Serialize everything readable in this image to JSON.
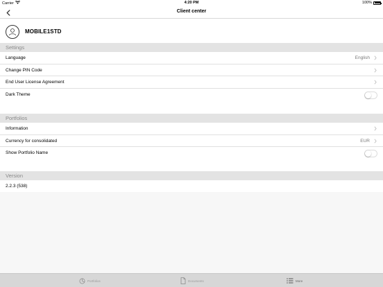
{
  "status_bar": {
    "carrier": "Carrier",
    "time": "4:20 PM",
    "battery": "100%"
  },
  "nav": {
    "title": "Client center"
  },
  "profile": {
    "name": "MOBILE1STD"
  },
  "settings": {
    "header": "Settings",
    "rows": [
      {
        "label": "Language",
        "value": "English"
      },
      {
        "label": "Change PIN Code",
        "value": ""
      },
      {
        "label": "End User License Agreement",
        "value": ""
      },
      {
        "label": "Dark Theme",
        "toggle": false
      }
    ]
  },
  "portfolios": {
    "header": "Portfolios",
    "rows": [
      {
        "label": "Information",
        "value": ""
      },
      {
        "label": "Currency for consolidated",
        "value": "EUR"
      },
      {
        "label": "Show Portfolio Name",
        "toggle": false
      }
    ]
  },
  "version": {
    "header": "Version",
    "value": "2.2.3 (538)"
  },
  "tabs": [
    {
      "label": "Portfolios",
      "icon": "pie-chart-icon"
    },
    {
      "label": "Documents",
      "icon": "document-icon"
    },
    {
      "label": "More",
      "icon": "list-icon",
      "active": true
    }
  ]
}
